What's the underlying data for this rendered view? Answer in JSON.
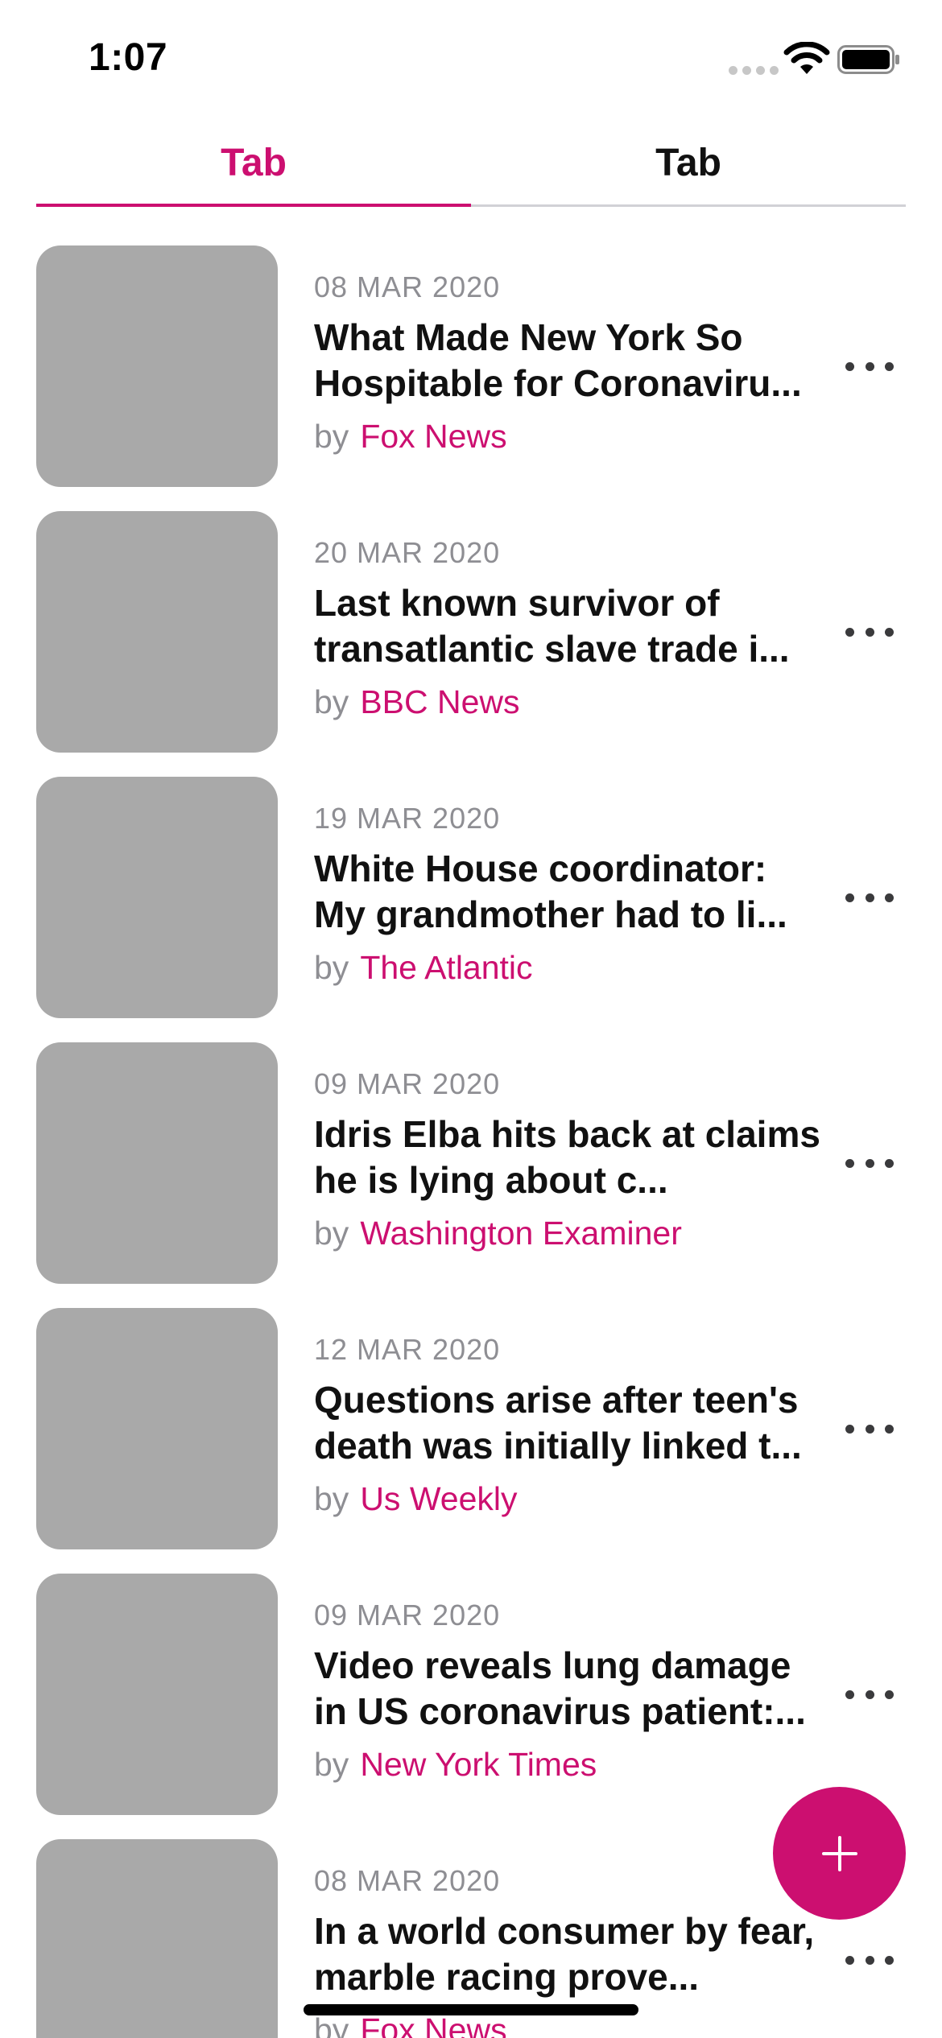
{
  "status_bar": {
    "time": "1:07"
  },
  "tabs": [
    {
      "label": "Tab",
      "selected": true
    },
    {
      "label": "Tab",
      "selected": false
    }
  ],
  "articles": [
    {
      "date": "08 MAR 2020",
      "title": "What Made New York So Hospitable for Coronaviru...",
      "by": "by",
      "source": "Fox News"
    },
    {
      "date": "20 MAR 2020",
      "title": "Last known survivor of transatlantic slave trade i...",
      "by": "by",
      "source": "BBC News"
    },
    {
      "date": "19 MAR 2020",
      "title": "White House coordinator: My grandmother had to li...",
      "by": "by",
      "source": "The Atlantic"
    },
    {
      "date": "09 MAR 2020",
      "title": "Idris Elba hits back at claims he is lying about c...",
      "by": "by",
      "source": "Washington Examiner"
    },
    {
      "date": "12 MAR 2020",
      "title": "Questions arise after teen's death was initially linked t...",
      "by": "by",
      "source": "Us Weekly"
    },
    {
      "date": "09 MAR 2020",
      "title": "Video reveals lung damage in US coronavirus patient:...",
      "by": "by",
      "source": "New York Times"
    },
    {
      "date": "08 MAR 2020",
      "title": "In a world consumer by fear, marble racing prove...",
      "by": "by",
      "source": "Fox News"
    }
  ],
  "fab": {
    "icon": "plus-icon"
  },
  "colors": {
    "accent": "#cc0f70",
    "thumbnail": "#a9a9a9",
    "secondary_text": "#8e8e93"
  }
}
